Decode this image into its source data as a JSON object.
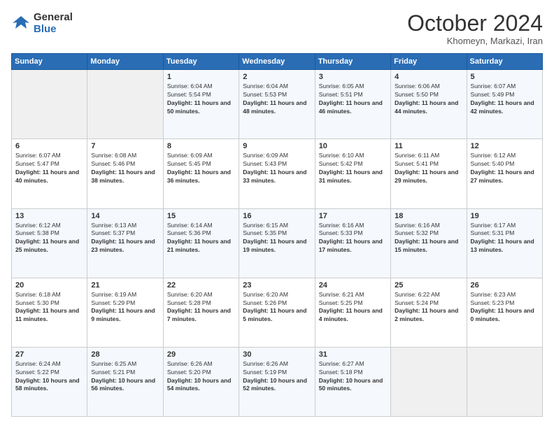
{
  "header": {
    "logo_line1": "General",
    "logo_line2": "Blue",
    "month": "October 2024",
    "location": "Khomeyn, Markazi, Iran"
  },
  "days_of_week": [
    "Sunday",
    "Monday",
    "Tuesday",
    "Wednesday",
    "Thursday",
    "Friday",
    "Saturday"
  ],
  "weeks": [
    [
      {
        "day": "",
        "content": ""
      },
      {
        "day": "",
        "content": ""
      },
      {
        "day": "1",
        "content": "Sunrise: 6:04 AM\nSunset: 5:54 PM\nDaylight: 11 hours and 50 minutes."
      },
      {
        "day": "2",
        "content": "Sunrise: 6:04 AM\nSunset: 5:53 PM\nDaylight: 11 hours and 48 minutes."
      },
      {
        "day": "3",
        "content": "Sunrise: 6:05 AM\nSunset: 5:51 PM\nDaylight: 11 hours and 46 minutes."
      },
      {
        "day": "4",
        "content": "Sunrise: 6:06 AM\nSunset: 5:50 PM\nDaylight: 11 hours and 44 minutes."
      },
      {
        "day": "5",
        "content": "Sunrise: 6:07 AM\nSunset: 5:49 PM\nDaylight: 11 hours and 42 minutes."
      }
    ],
    [
      {
        "day": "6",
        "content": "Sunrise: 6:07 AM\nSunset: 5:47 PM\nDaylight: 11 hours and 40 minutes."
      },
      {
        "day": "7",
        "content": "Sunrise: 6:08 AM\nSunset: 5:46 PM\nDaylight: 11 hours and 38 minutes."
      },
      {
        "day": "8",
        "content": "Sunrise: 6:09 AM\nSunset: 5:45 PM\nDaylight: 11 hours and 36 minutes."
      },
      {
        "day": "9",
        "content": "Sunrise: 6:09 AM\nSunset: 5:43 PM\nDaylight: 11 hours and 33 minutes."
      },
      {
        "day": "10",
        "content": "Sunrise: 6:10 AM\nSunset: 5:42 PM\nDaylight: 11 hours and 31 minutes."
      },
      {
        "day": "11",
        "content": "Sunrise: 6:11 AM\nSunset: 5:41 PM\nDaylight: 11 hours and 29 minutes."
      },
      {
        "day": "12",
        "content": "Sunrise: 6:12 AM\nSunset: 5:40 PM\nDaylight: 11 hours and 27 minutes."
      }
    ],
    [
      {
        "day": "13",
        "content": "Sunrise: 6:12 AM\nSunset: 5:38 PM\nDaylight: 11 hours and 25 minutes."
      },
      {
        "day": "14",
        "content": "Sunrise: 6:13 AM\nSunset: 5:37 PM\nDaylight: 11 hours and 23 minutes."
      },
      {
        "day": "15",
        "content": "Sunrise: 6:14 AM\nSunset: 5:36 PM\nDaylight: 11 hours and 21 minutes."
      },
      {
        "day": "16",
        "content": "Sunrise: 6:15 AM\nSunset: 5:35 PM\nDaylight: 11 hours and 19 minutes."
      },
      {
        "day": "17",
        "content": "Sunrise: 6:16 AM\nSunset: 5:33 PM\nDaylight: 11 hours and 17 minutes."
      },
      {
        "day": "18",
        "content": "Sunrise: 6:16 AM\nSunset: 5:32 PM\nDaylight: 11 hours and 15 minutes."
      },
      {
        "day": "19",
        "content": "Sunrise: 6:17 AM\nSunset: 5:31 PM\nDaylight: 11 hours and 13 minutes."
      }
    ],
    [
      {
        "day": "20",
        "content": "Sunrise: 6:18 AM\nSunset: 5:30 PM\nDaylight: 11 hours and 11 minutes."
      },
      {
        "day": "21",
        "content": "Sunrise: 6:19 AM\nSunset: 5:29 PM\nDaylight: 11 hours and 9 minutes."
      },
      {
        "day": "22",
        "content": "Sunrise: 6:20 AM\nSunset: 5:28 PM\nDaylight: 11 hours and 7 minutes."
      },
      {
        "day": "23",
        "content": "Sunrise: 6:20 AM\nSunset: 5:26 PM\nDaylight: 11 hours and 5 minutes."
      },
      {
        "day": "24",
        "content": "Sunrise: 6:21 AM\nSunset: 5:25 PM\nDaylight: 11 hours and 4 minutes."
      },
      {
        "day": "25",
        "content": "Sunrise: 6:22 AM\nSunset: 5:24 PM\nDaylight: 11 hours and 2 minutes."
      },
      {
        "day": "26",
        "content": "Sunrise: 6:23 AM\nSunset: 5:23 PM\nDaylight: 11 hours and 0 minutes."
      }
    ],
    [
      {
        "day": "27",
        "content": "Sunrise: 6:24 AM\nSunset: 5:22 PM\nDaylight: 10 hours and 58 minutes."
      },
      {
        "day": "28",
        "content": "Sunrise: 6:25 AM\nSunset: 5:21 PM\nDaylight: 10 hours and 56 minutes."
      },
      {
        "day": "29",
        "content": "Sunrise: 6:26 AM\nSunset: 5:20 PM\nDaylight: 10 hours and 54 minutes."
      },
      {
        "day": "30",
        "content": "Sunrise: 6:26 AM\nSunset: 5:19 PM\nDaylight: 10 hours and 52 minutes."
      },
      {
        "day": "31",
        "content": "Sunrise: 6:27 AM\nSunset: 5:18 PM\nDaylight: 10 hours and 50 minutes."
      },
      {
        "day": "",
        "content": ""
      },
      {
        "day": "",
        "content": ""
      }
    ]
  ]
}
